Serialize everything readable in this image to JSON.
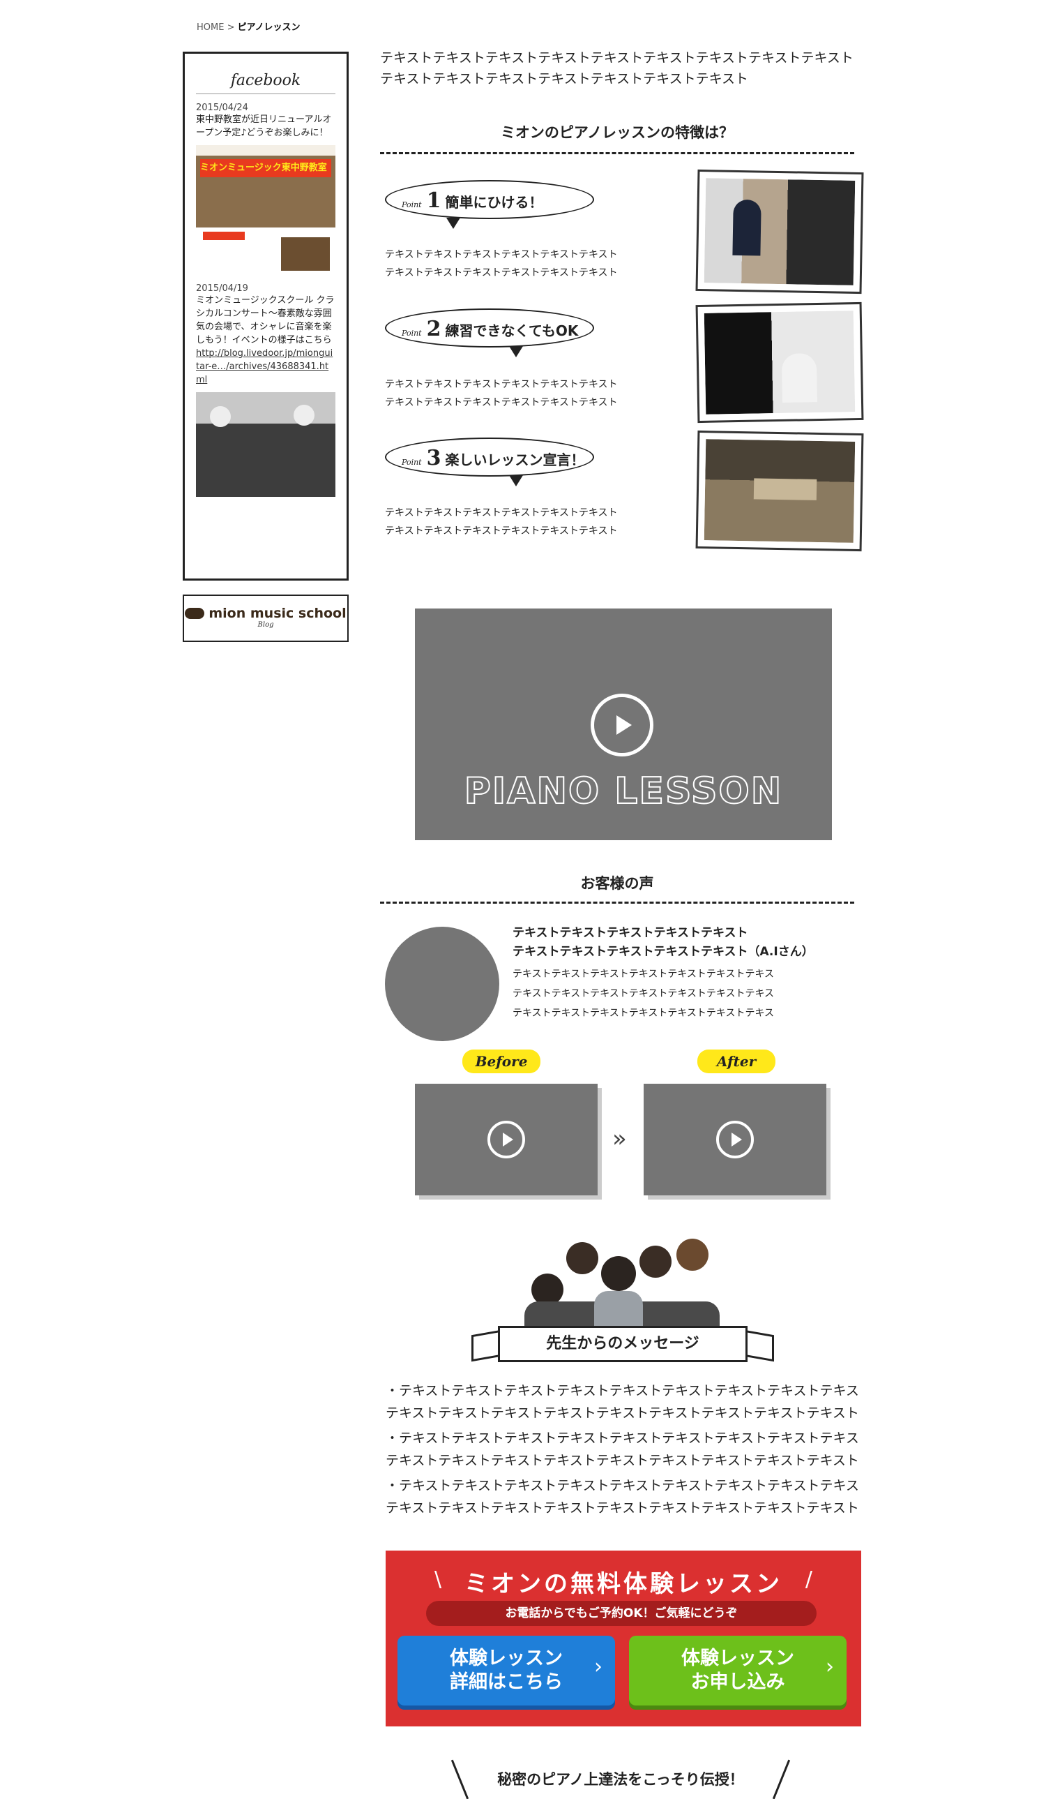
{
  "breadcrumb": {
    "home": "HOME",
    "sep": ">",
    "current": "ピアノレッスン"
  },
  "sidebar": {
    "facebook_title": "facebook",
    "posts": [
      {
        "date": "2015/04/24",
        "text": "東中野教室が近日リニューアルオープン予定♪どうぞお楽しみに！",
        "image_caption": "ミオンミュージック東中野教室 リニューアルオープン♪"
      },
      {
        "date": "2015/04/19",
        "text": "ミオンミュージックスクール クラシカルコンサート〜春素敵な雰囲気の会場で、オシャレに音楽を楽しもう！イベントの様子はこちら",
        "link": "http://blog.livedoor.jp/mionguitar-e…/archives/43688341.html"
      }
    ],
    "blog_logo": "mion music school",
    "blog_sub": "Blog"
  },
  "main": {
    "intro": "テキストテキストテキストテキストテキストテキストテキストテキストテキストテキストテキストテキストテキストテキストテキストテキスト",
    "features_heading": "ミオンのピアノレッスンの特徴は？",
    "points": [
      {
        "label": "Point",
        "num": "1",
        "title": "簡単にひける！",
        "text1": "テキストテキストテキストテキストテキストテキスト",
        "text2": "テキストテキストテキストテキストテキストテキスト"
      },
      {
        "label": "Point",
        "num": "2",
        "title": "練習できなくてもOK",
        "text1": "テキストテキストテキストテキストテキストテキスト",
        "text2": "テキストテキストテキストテキストテキストテキスト"
      },
      {
        "label": "Point",
        "num": "3",
        "title": "楽しいレッスン宣言！",
        "text1": "テキストテキストテキストテキストテキストテキスト",
        "text2": "テキストテキストテキストテキストテキストテキスト"
      }
    ],
    "video_title": "PIANO LESSON",
    "voices_heading": "お客様の声",
    "voice": {
      "head1": "テキストテキストテキストテキストテキスト",
      "head2": "テキストテキストテキストテキストテキスト（A.Iさん）",
      "lines": [
        "テキストテキストテキストテキストテキストテキストテキス",
        "テキストテキストテキストテキストテキストテキストテキス",
        "テキストテキストテキストテキストテキストテキストテキス"
      ]
    },
    "before_label": "Before",
    "after_label": "After",
    "arrow": "»",
    "teacher_heading": "先生からのメッセージ",
    "messages": [
      "・テキストテキストテキストテキストテキストテキストテキストテキストテキス",
      "テキストテキストテキストテキストテキストテキストテキストテキストテキスト",
      "・テキストテキストテキストテキストテキストテキストテキストテキストテキス",
      "テキストテキストテキストテキストテキストテキストテキストテキストテキスト",
      "・テキストテキストテキストテキストテキストテキストテキストテキストテキス",
      "テキストテキストテキストテキストテキストテキストテキストテキストテキスト"
    ],
    "banner": {
      "title": "ミオンの無料体験レッスン",
      "subtitle": "お電話からでもご予約OK！ご気軽にどうぞ",
      "btn1_line1": "体験レッスン",
      "btn1_line2": "詳細はこちら",
      "btn2_line1": "体験レッスン",
      "btn2_line2": "お申し込み",
      "arrow": "›"
    },
    "secret": "秘密のピアノ上達法をこっそり伝授！"
  },
  "colors": {
    "accent_red": "#db3030",
    "blue": "#1f7fd9",
    "green": "#6dc01b",
    "yellow": "#ffe81a",
    "video_gray": "#757575"
  }
}
